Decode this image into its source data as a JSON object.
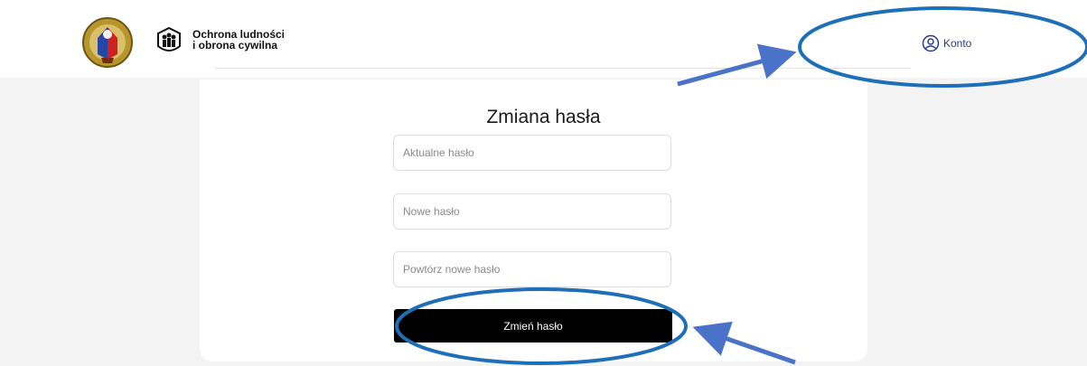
{
  "header": {
    "brand_line1": "Ochrona ludności",
    "brand_line2": "i obrona cywilna",
    "crest_icon": "coat-of-arms-icon",
    "ocl_icon": "civil-protection-logo-icon",
    "account_icon": "user-circle-icon",
    "account_label": "Konto"
  },
  "form": {
    "title": "Zmiana hasła",
    "current_password_placeholder": "Aktualne hasło",
    "new_password_placeholder": "Nowe hasło",
    "repeat_password_placeholder": "Powtórz nowe hasło",
    "submit_label": "Zmień hasło"
  },
  "annotations": {
    "highlight_color": "#1f6fb8",
    "arrow_color": "#4a72c8"
  }
}
